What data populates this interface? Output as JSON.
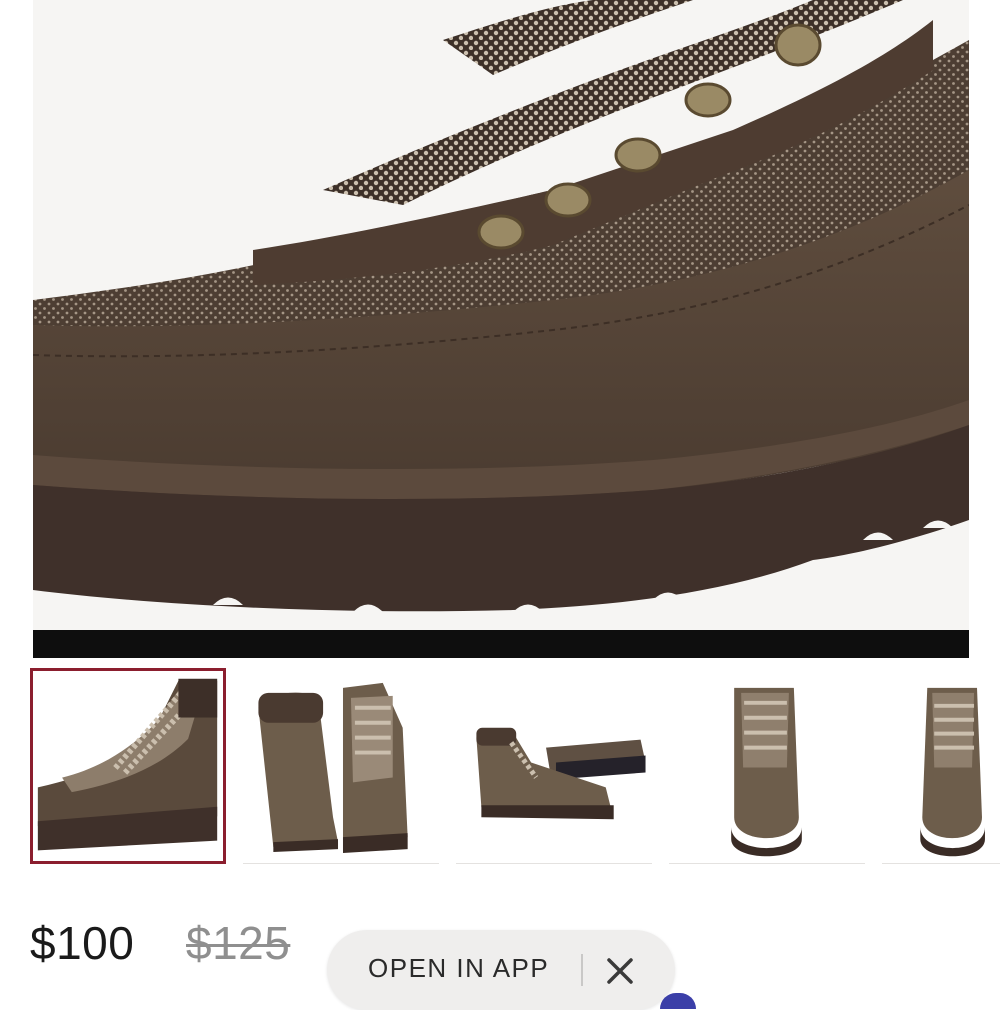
{
  "product": {
    "price_current": "$100",
    "price_original": "$125"
  },
  "gallery": {
    "selected_index": 0,
    "thumbnails": [
      {
        "view": "side-angle closeup"
      },
      {
        "view": "back and front pair"
      },
      {
        "view": "side and sole pair"
      },
      {
        "view": "front view"
      },
      {
        "view": "front view partial"
      }
    ]
  },
  "app_banner": {
    "label": "OPEN IN APP",
    "close_icon": "close-icon"
  },
  "colors": {
    "selected_border": "#8b1e2e",
    "boot_brown": "#5a4a3c",
    "sole_dark": "#3f302a"
  }
}
